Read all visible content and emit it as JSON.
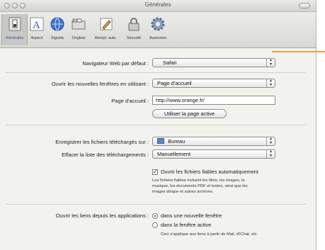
{
  "window": {
    "title": "Générales"
  },
  "toolbar": {
    "items": [
      {
        "label": "Générales",
        "icon": "switch-icon"
      },
      {
        "label": "Aspect",
        "icon": "font-icon"
      },
      {
        "label": "Signets",
        "icon": "globe-icon"
      },
      {
        "label": "Onglets",
        "icon": "tabs-icon"
      },
      {
        "label": "Rempl. auto.",
        "icon": "pencil-icon"
      },
      {
        "label": "Sécurité",
        "icon": "lock-icon"
      },
      {
        "label": "Avancées",
        "icon": "gear-icon"
      }
    ]
  },
  "prefs": {
    "default_browser": {
      "label": "Navigateur Web par défaut :",
      "value": "Safari"
    },
    "new_windows": {
      "label": "Ouvrir les nouvelles fenêtres en utilisant :",
      "value": "Page d'accueil"
    },
    "homepage": {
      "label": "Page d'accueil :",
      "value": "http://www.orange.fr/",
      "button": "Utiliser la page active"
    },
    "downloads": {
      "label": "Enregistrer les fichiers téléchargés sur :",
      "value": "Bureau"
    },
    "clear_downloads": {
      "label": "Effacer la liste des téléchargements :",
      "value": "Manuellement"
    },
    "open_safe": {
      "label": "Ouvrir les fichiers fiables automatiquement",
      "checked": true,
      "note": [
        "Les fichiers fiables incluent les films, les images, la",
        "musique, les documents PDF et textes, ainsi que les",
        "images disque et autres archives."
      ]
    },
    "open_links": {
      "label": "Ouvrir les liens depuis les applications :",
      "options": [
        "dans une nouvelle fenêtre",
        "dans la fenêtre active"
      ],
      "selected": 0,
      "note": "Ceci s'applique aux liens à partir de Mail, d'iChat, etc."
    }
  },
  "colors": {
    "pointer": "#f2a03a"
  }
}
